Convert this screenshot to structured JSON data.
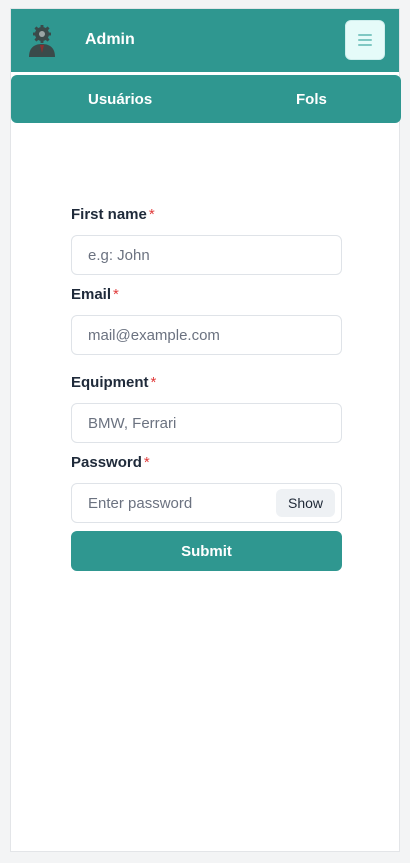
{
  "header": {
    "brand": "Admin",
    "menu_icon": "hamburger-menu-icon",
    "avatar_icon": "admin-gear-avatar-icon"
  },
  "subnav": {
    "items": [
      {
        "label": "Usuários"
      },
      {
        "label": "Fols"
      }
    ]
  },
  "form": {
    "first_name": {
      "label": "First name",
      "required_mark": "*",
      "placeholder": "e.g: John"
    },
    "email": {
      "label": "Email",
      "required_mark": "*",
      "placeholder": "mail@example.com"
    },
    "equipment": {
      "label": "Equipment",
      "required_mark": "*",
      "placeholder": "BMW, Ferrari"
    },
    "password": {
      "label": "Password",
      "required_mark": "*",
      "placeholder": "Enter password",
      "toggle_label": "Show"
    },
    "submit_label": "Submit"
  },
  "colors": {
    "primary": "#2f9790",
    "required": "#e03a3a",
    "menu_button_bg": "#e5fbf9"
  }
}
